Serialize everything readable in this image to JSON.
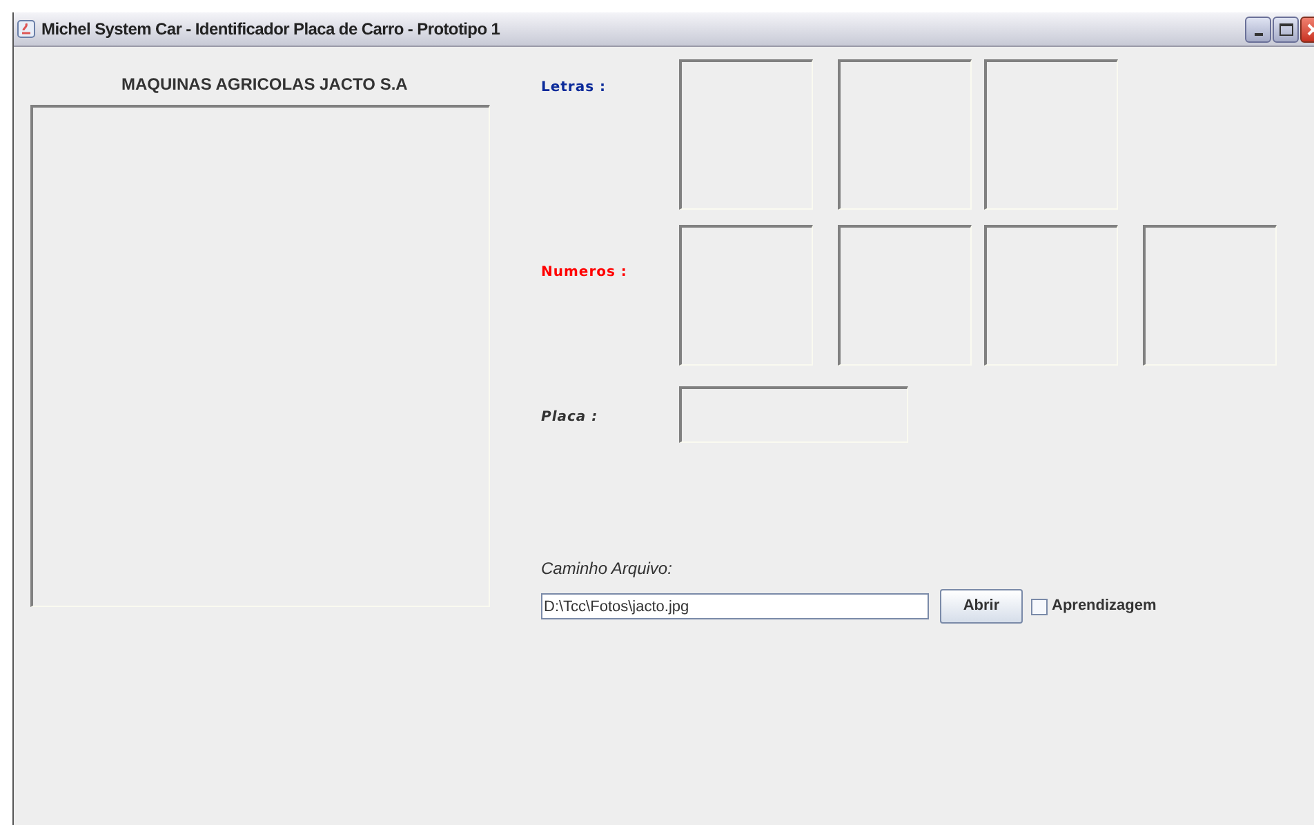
{
  "window": {
    "title": "Michel System Car - Identificador Placa de Carro - Prototipo 1"
  },
  "image_panel": {
    "title": "MAQUINAS AGRICOLAS JACTO S.A"
  },
  "letters": {
    "label": "Letras :"
  },
  "numbers": {
    "label": "Numeros :"
  },
  "plate": {
    "label": "Placa :"
  },
  "file": {
    "label": "Caminho Arquivo:",
    "value": "D:\\Tcc\\Fotos\\jacto.jpg",
    "button": "Abrir",
    "checkbox": {
      "label": "Aprendizagem",
      "checked": false
    }
  }
}
